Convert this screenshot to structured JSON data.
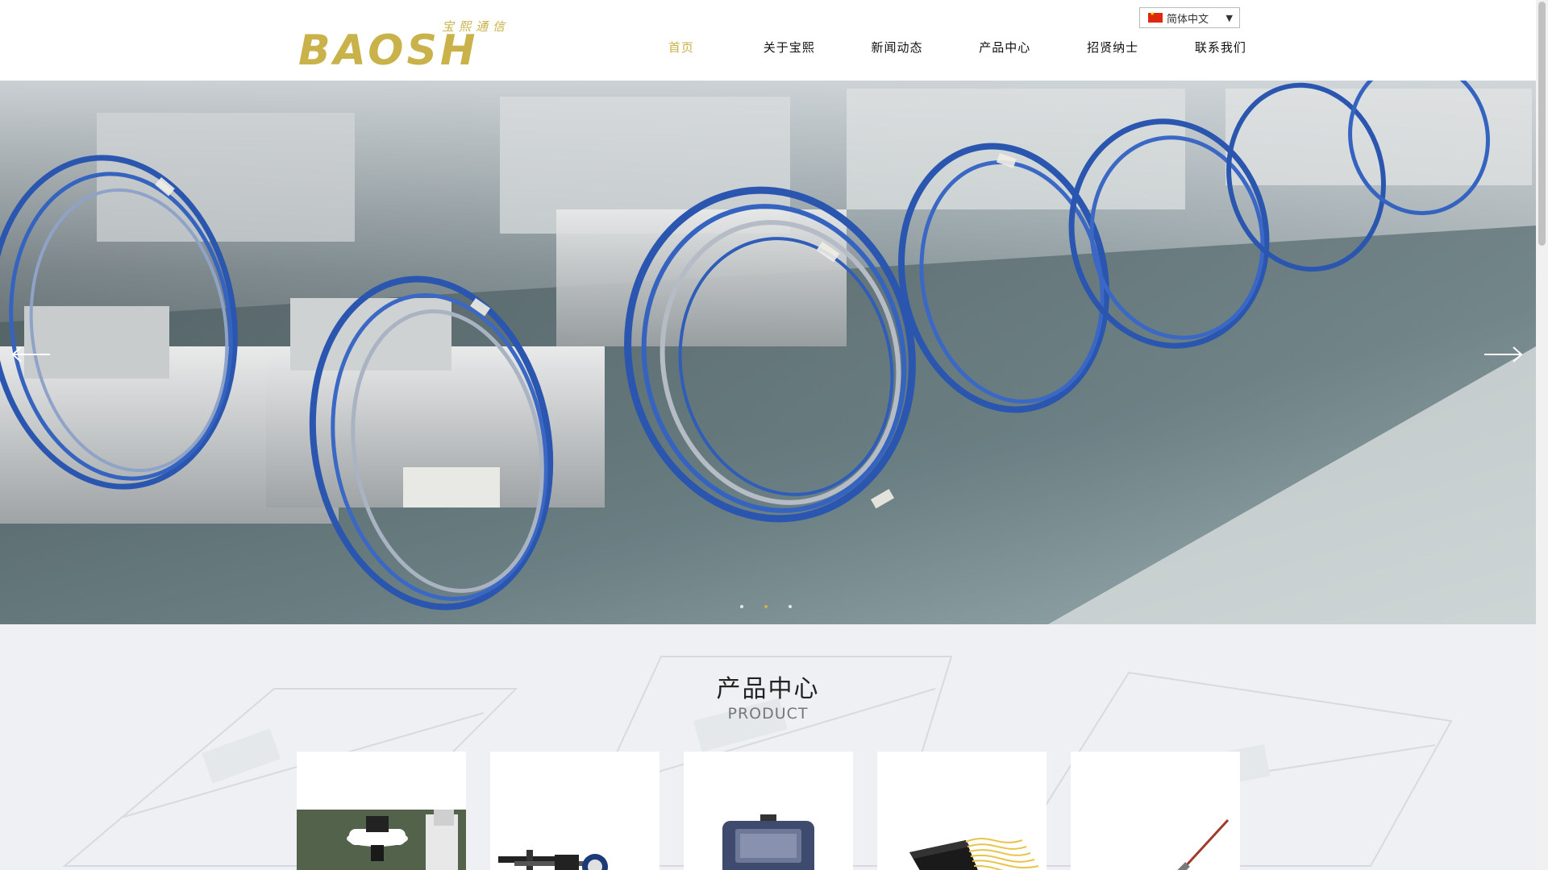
{
  "header": {
    "logo_text": "BAOSH",
    "logo_cn": "宝熙通信",
    "language": "简体中文",
    "nav": [
      {
        "label": "首页",
        "active": true
      },
      {
        "label": "关于宝熙",
        "active": false
      },
      {
        "label": "新闻动态",
        "active": false
      },
      {
        "label": "产品中心",
        "active": false
      },
      {
        "label": "招贤纳士",
        "active": false
      },
      {
        "label": "联系我们",
        "active": false
      }
    ]
  },
  "hero": {
    "slide_count": 3,
    "active_slide": 2
  },
  "products": {
    "title": "产品中心",
    "subtitle": "PRODUCT",
    "cards": [
      {
        "icon": "microscope-image"
      },
      {
        "icon": "fiber-fixture-image"
      },
      {
        "icon": "handheld-meter-image"
      },
      {
        "icon": "fiber-splitter-image"
      },
      {
        "icon": "fiber-collimator-image"
      }
    ]
  },
  "colors": {
    "accent": "#c9b24a",
    "nav_text": "#111111",
    "section_bg": "#eef0f3",
    "fiber_blue": "#2a56b0"
  }
}
